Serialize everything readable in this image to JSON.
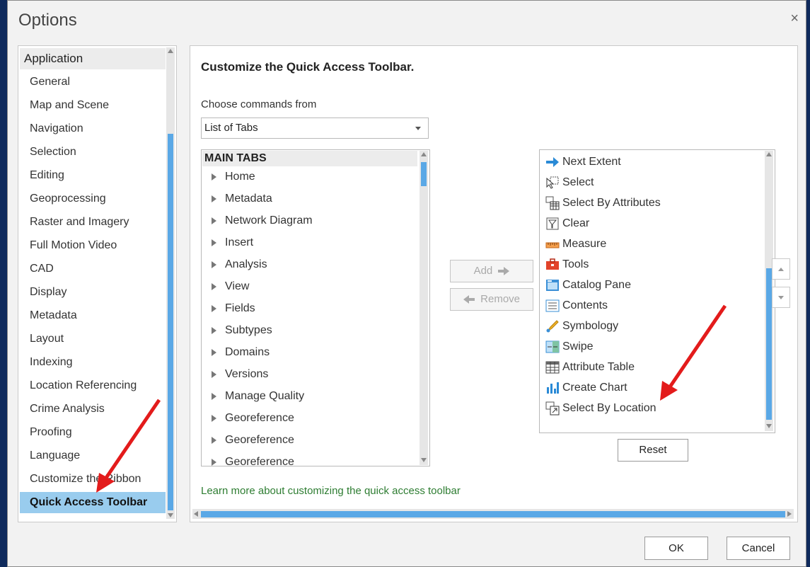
{
  "window": {
    "title": "Options",
    "close_glyph": "×"
  },
  "nav": {
    "header": "Application",
    "items": [
      {
        "label": "General"
      },
      {
        "label": "Map and Scene"
      },
      {
        "label": "Navigation"
      },
      {
        "label": "Selection"
      },
      {
        "label": "Editing"
      },
      {
        "label": "Geoprocessing"
      },
      {
        "label": "Raster and Imagery"
      },
      {
        "label": "Full Motion Video"
      },
      {
        "label": "CAD"
      },
      {
        "label": "Display"
      },
      {
        "label": "Metadata"
      },
      {
        "label": "Layout"
      },
      {
        "label": "Indexing"
      },
      {
        "label": "Location Referencing"
      },
      {
        "label": "Crime Analysis"
      },
      {
        "label": "Proofing"
      },
      {
        "label": "Language"
      },
      {
        "label": "Customize the Ribbon"
      },
      {
        "label": "Quick Access Toolbar",
        "selected": true
      }
    ]
  },
  "content": {
    "heading": "Customize the Quick Access Toolbar.",
    "choose_label": "Choose commands from",
    "choose_value": "List of Tabs",
    "tabs_header": "MAIN TABS",
    "tabs": [
      {
        "label": "Home"
      },
      {
        "label": "Metadata"
      },
      {
        "label": "Network Diagram"
      },
      {
        "label": "Insert"
      },
      {
        "label": "Analysis"
      },
      {
        "label": "View"
      },
      {
        "label": "Fields"
      },
      {
        "label": "Subtypes"
      },
      {
        "label": "Domains"
      },
      {
        "label": "Versions"
      },
      {
        "label": "Manage Quality"
      },
      {
        "label": "Georeference"
      },
      {
        "label": "Georeference"
      },
      {
        "label": "Georeference"
      }
    ],
    "add_label": "Add",
    "remove_label": "Remove",
    "qat_items": [
      {
        "label": "Next Extent",
        "icon": "next-extent-icon"
      },
      {
        "label": "Select",
        "icon": "select-icon"
      },
      {
        "label": "Select By Attributes",
        "icon": "select-by-attributes-icon"
      },
      {
        "label": "Clear",
        "icon": "clear-selection-icon"
      },
      {
        "label": "Measure",
        "icon": "measure-icon"
      },
      {
        "label": "Tools",
        "icon": "toolbox-icon"
      },
      {
        "label": "Catalog Pane",
        "icon": "catalog-icon"
      },
      {
        "label": "Contents",
        "icon": "contents-icon"
      },
      {
        "label": "Symbology",
        "icon": "symbology-icon"
      },
      {
        "label": "Swipe",
        "icon": "swipe-icon"
      },
      {
        "label": "Attribute Table",
        "icon": "table-icon"
      },
      {
        "label": "Create Chart",
        "icon": "chart-icon"
      },
      {
        "label": "Select By Location",
        "icon": "select-by-location-icon"
      }
    ],
    "reset_label": "Reset",
    "learn_more": "Learn more about customizing the quick access toolbar"
  },
  "footer": {
    "ok_label": "OK",
    "cancel_label": "Cancel"
  },
  "colors": {
    "accent": "#5aa8e6",
    "selected_bg": "#99ccee",
    "link": "#2e7d32",
    "annotation_arrow": "#e31b1b",
    "background": "#0f2a5c"
  }
}
